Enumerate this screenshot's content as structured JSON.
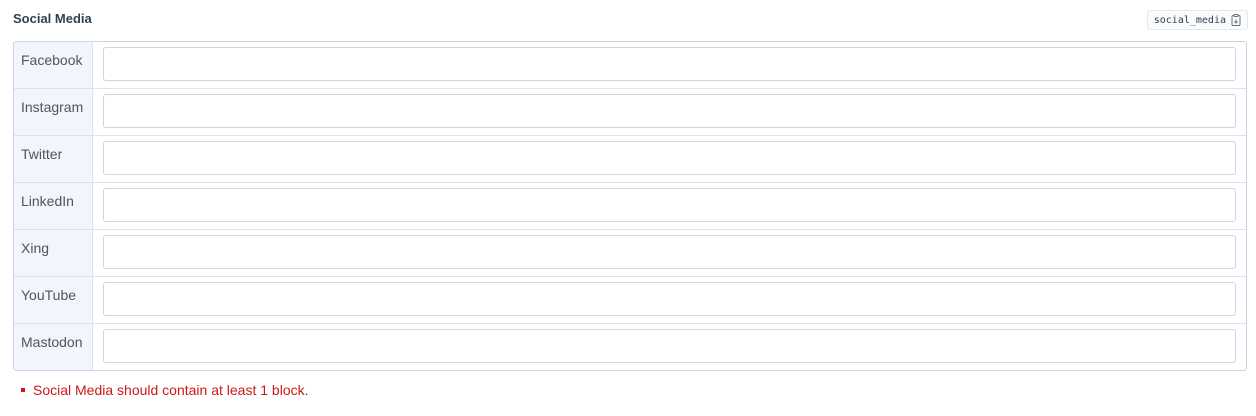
{
  "field": {
    "title": "Social Media",
    "key": "social_media"
  },
  "rows": [
    {
      "label": "Facebook",
      "value": ""
    },
    {
      "label": "Instagram",
      "value": ""
    },
    {
      "label": "Twitter",
      "value": ""
    },
    {
      "label": "LinkedIn",
      "value": ""
    },
    {
      "label": "Xing",
      "value": ""
    },
    {
      "label": "YouTube",
      "value": ""
    },
    {
      "label": "Mastodon",
      "value": ""
    }
  ],
  "error": {
    "message": "Social Media should contain at least 1 block.",
    "color": "#cc1818"
  },
  "icons": {
    "copy": "clipboard-copy-icon"
  }
}
